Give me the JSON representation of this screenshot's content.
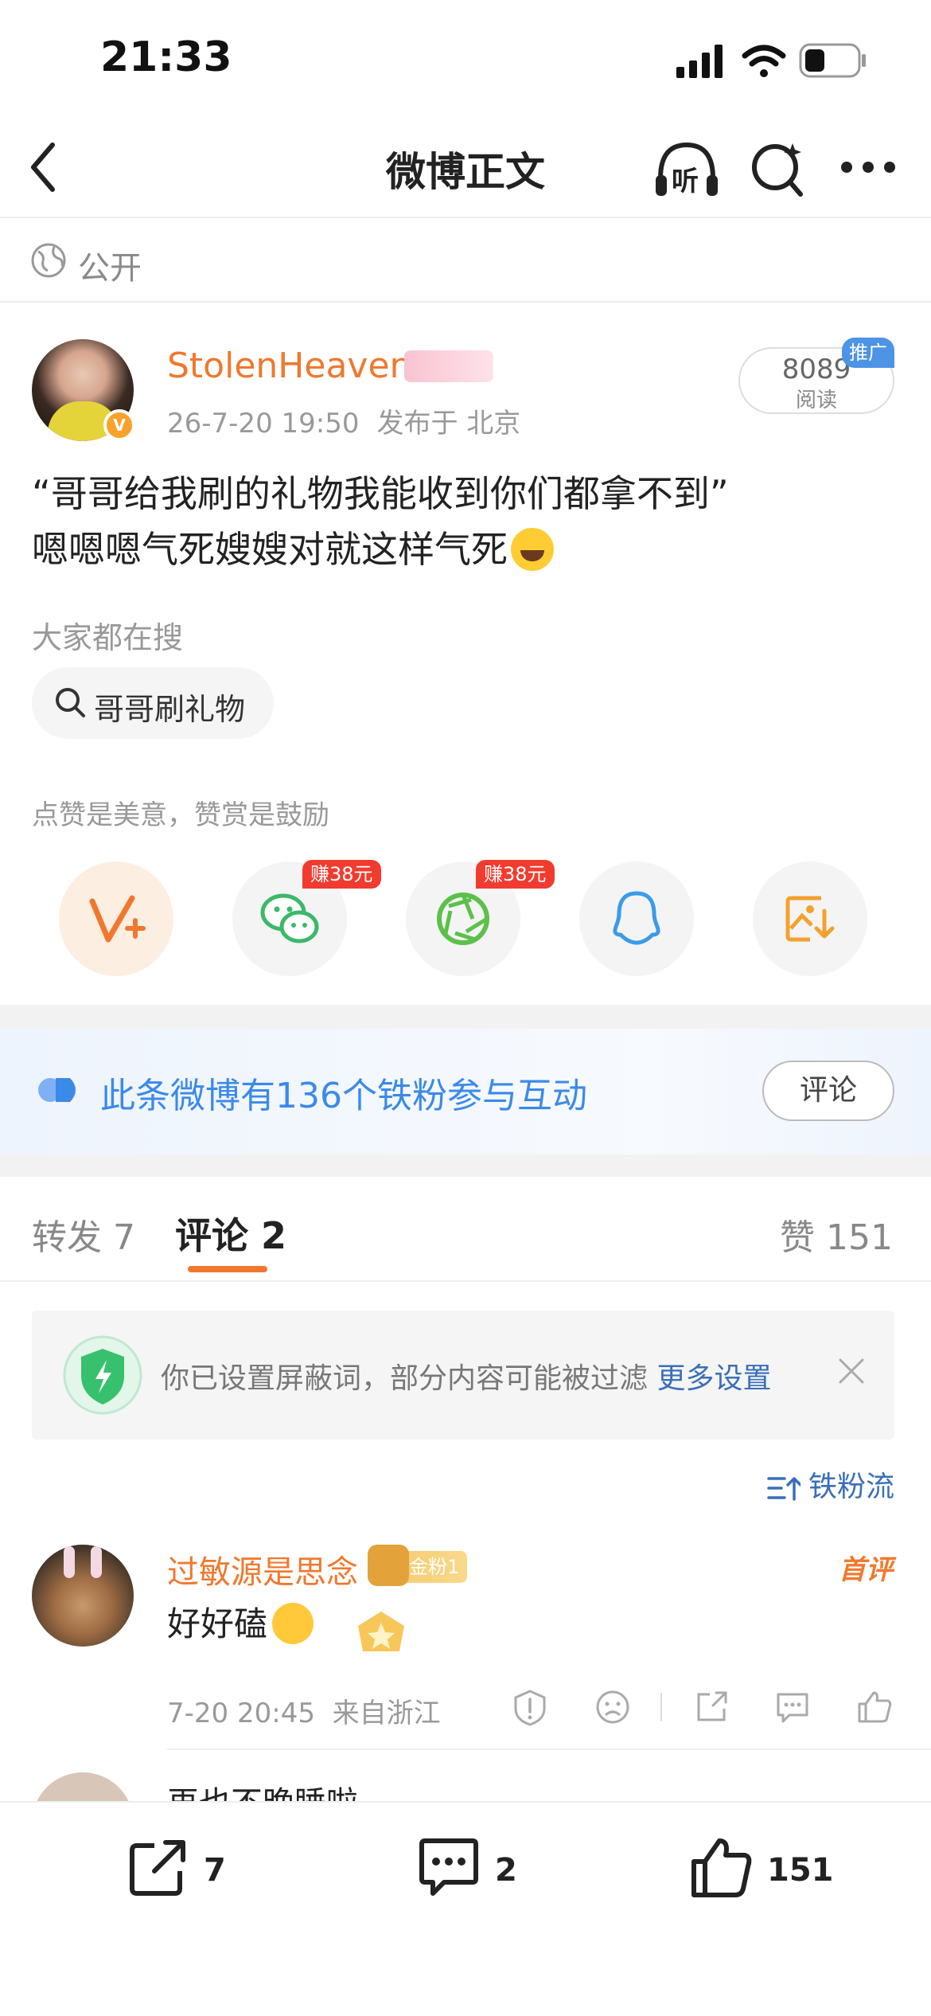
{
  "status_bar": {
    "time": "21:33"
  },
  "nav": {
    "title": "微博正文",
    "listen_label": "听"
  },
  "visibility": {
    "label": "公开"
  },
  "post": {
    "username": "StolenHeaven",
    "date": "26-7-20 19:50",
    "location": "发布于 北京",
    "reads": "8089",
    "reads_label": "阅读",
    "promo_tag": "推广",
    "text_line1": "“哥哥给我刷的礼物我能收到你们都拿不到”",
    "text_line2": "嗯嗯嗯气死嫂嫂对就这样气死",
    "search_hint": "大家都在搜",
    "search_chip": "哥哥刷礼物",
    "like_hint": "点赞是美意，赞赏是鼓励"
  },
  "share": {
    "earn_wechat": "赚38元",
    "earn_moments": "赚38元"
  },
  "fans_banner": {
    "text": "此条微博有136个铁粉参与互动",
    "button": "评论"
  },
  "tabs": {
    "repost": "转发 7",
    "comment": "评论 2",
    "like": "赞 151"
  },
  "filter_notice": {
    "text": "你已设置屏蔽词，部分内容可能被过滤",
    "link": "更多设置"
  },
  "sort": {
    "label": "铁粉流"
  },
  "comments": [
    {
      "user": "过敏源是思念",
      "fan_badge": "金粉1",
      "first_tag": "首评",
      "text": "好好磕",
      "time": "7-20 20:45",
      "location": "来自浙江"
    },
    {
      "text": "再也不晚睡啦"
    }
  ],
  "bottom_bar": {
    "repost": "7",
    "comment": "2",
    "like": "151"
  },
  "colors": {
    "accent": "#f0782e",
    "link": "#3a6fb8",
    "banner_text": "#3b8ae8"
  }
}
